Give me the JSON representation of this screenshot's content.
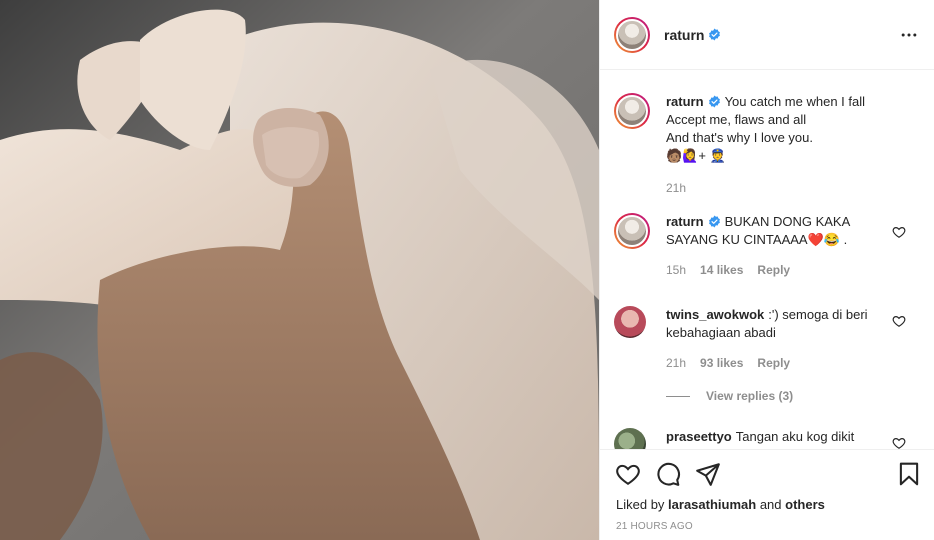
{
  "post": {
    "author": "raturn",
    "verified": true,
    "more_icon": "more-horizontal-icon"
  },
  "caption": {
    "username": "raturn",
    "text_line1": "You catch me when I fall",
    "text_line2": "Accept me, flaws and all",
    "text_line3": "And that's why I love you.",
    "emojis": "🧑🏽🙋‍♀️+ 👮",
    "time": "21h"
  },
  "comments": [
    {
      "username": "raturn",
      "verified": true,
      "text": "BUKAN DONG KAKA SAYANG KU CINTAAAA❤️😂 .",
      "time": "15h",
      "likes": "14 likes",
      "reply_label": "Reply"
    },
    {
      "username": "twins_awokwok",
      "verified": false,
      "text": ":') semoga di beri kebahagiaan abadi",
      "time": "21h",
      "likes": "93 likes",
      "reply_label": "Reply",
      "view_replies": "View replies (3)"
    },
    {
      "username": "praseettyo",
      "verified": false,
      "text": "Tangan aku kog dikit"
    }
  ],
  "actions": {
    "like_icon": "heart-icon",
    "comment_icon": "comment-icon",
    "share_icon": "paper-plane-icon",
    "save_icon": "bookmark-icon"
  },
  "liked_by": {
    "prefix": "Liked by",
    "user": "larasathiumah",
    "conj": "and",
    "others": "others"
  },
  "timestamp": "21 HOURS AGO",
  "colors": {
    "verified_blue": "#3897f0",
    "text_primary": "#262626",
    "text_secondary": "#8e8e8e",
    "border": "#efefef"
  }
}
